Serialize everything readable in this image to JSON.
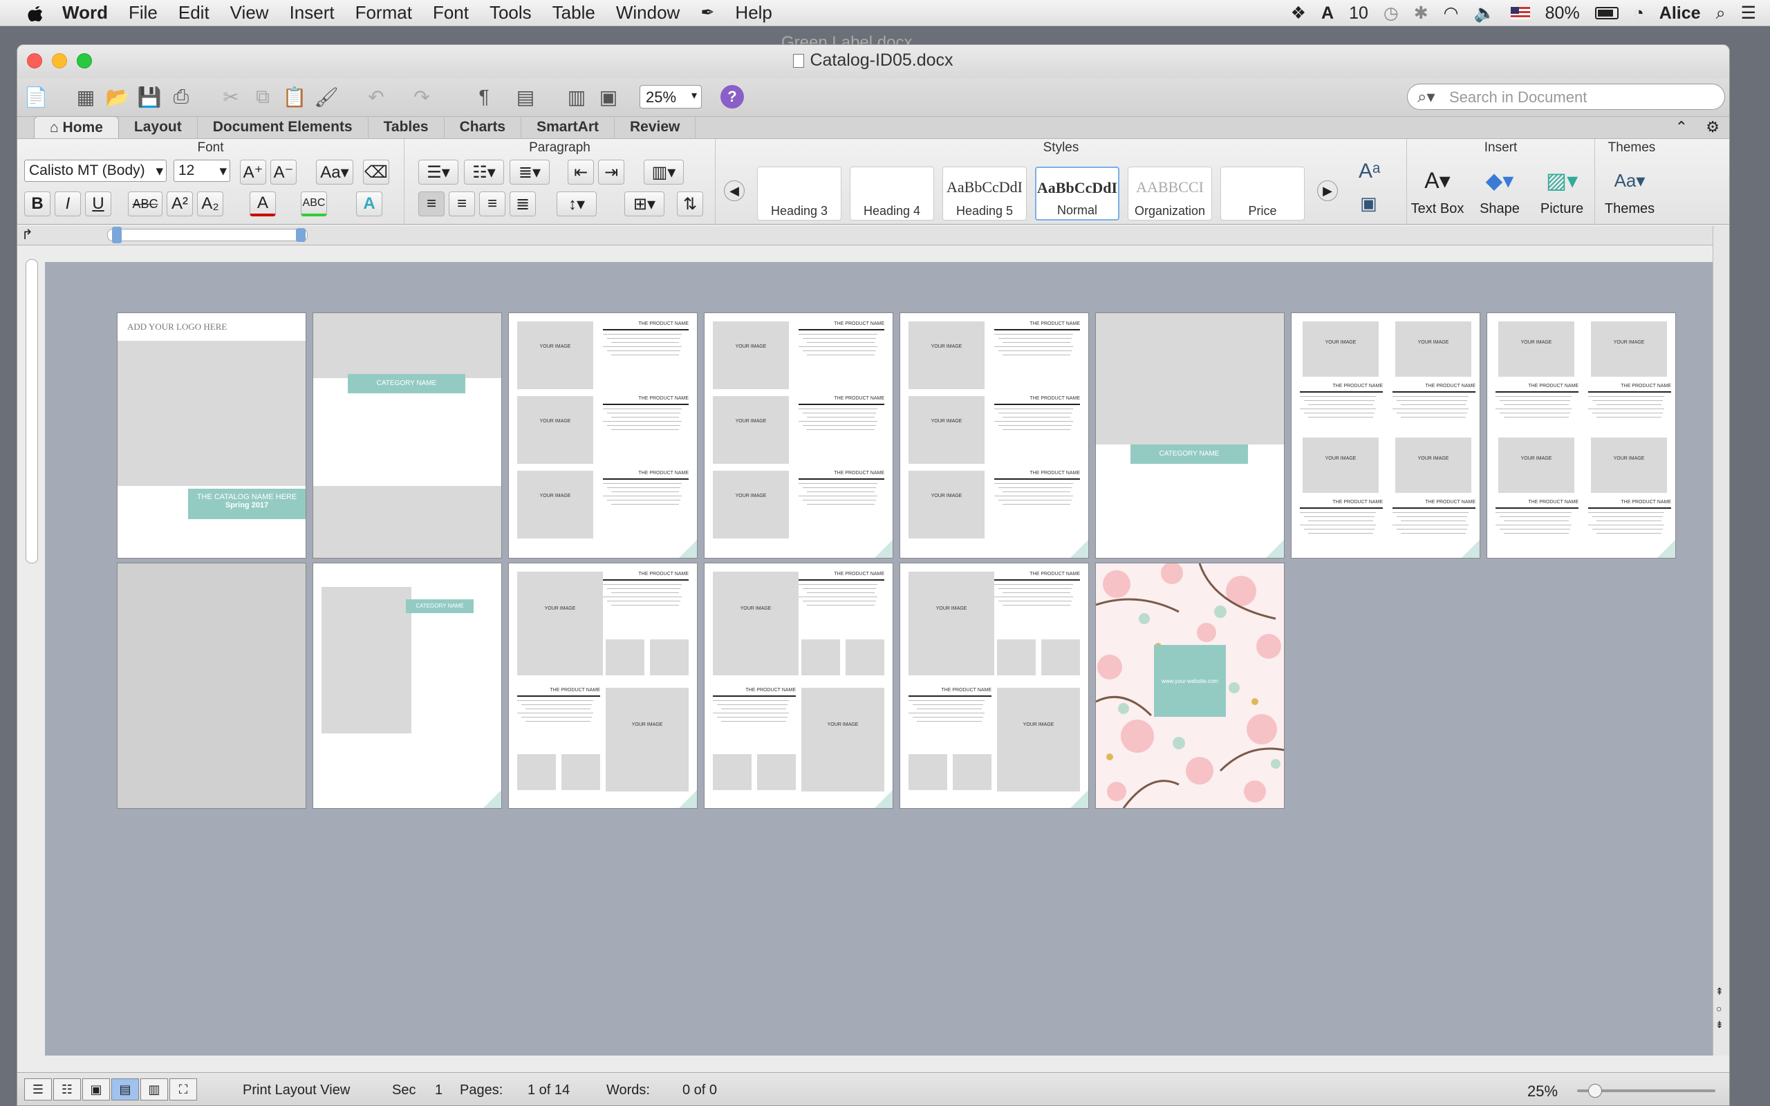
{
  "menubar": {
    "app": "Word",
    "items": [
      "File",
      "Edit",
      "View",
      "Insert",
      "Format",
      "Font",
      "Tools",
      "Table",
      "Window",
      "Help"
    ],
    "battery": "80%",
    "user": "Alice",
    "adobe_count": "10"
  },
  "window": {
    "title": "Catalog-ID05.docx",
    "ghost_title": "Green Label.docx"
  },
  "toolbar": {
    "zoom": "25%",
    "search_placeholder": "Search in Document",
    "help": "?"
  },
  "tabs": [
    "Home",
    "Layout",
    "Document Elements",
    "Tables",
    "Charts",
    "SmartArt",
    "Review"
  ],
  "ribbon": {
    "font_group": "Font",
    "font_name": "Calisto MT (Body)",
    "font_size": "12",
    "paragraph_group": "Paragraph",
    "styles_group": "Styles",
    "insert_group": "Insert",
    "themes_group": "Themes",
    "styles": [
      {
        "preview": "",
        "name": "Heading 3"
      },
      {
        "preview": "",
        "name": "Heading 4"
      },
      {
        "preview": "AaBbCcDdI",
        "name": "Heading 5"
      },
      {
        "preview": "AaBbCcDdI",
        "name": "Normal"
      },
      {
        "preview": "AABBCCI",
        "name": "Organization"
      },
      {
        "preview": "",
        "name": "Price"
      }
    ],
    "insert_items": [
      "Text Box",
      "Shape",
      "Picture"
    ],
    "themes_label": "Themes"
  },
  "pages": {
    "logo_text": "ADD YOUR LOGO HERE",
    "catalog_name": "THE CATALOG NAME HERE",
    "season": "Spring 2017",
    "category": "CATEGORY NAME",
    "your_image": "YOUR IMAGE",
    "product_name": "THE PRODUCT NAME",
    "website": "www.your-website.com"
  },
  "statusbar": {
    "view": "Print Layout View",
    "sec_label": "Sec",
    "sec": "1",
    "pages_label": "Pages:",
    "pages": "1 of 14",
    "words_label": "Words:",
    "words": "0 of 0",
    "zoom": "25%"
  },
  "colors": {
    "teal": "#93cbc3",
    "blue_select": "#9fc2ef"
  }
}
